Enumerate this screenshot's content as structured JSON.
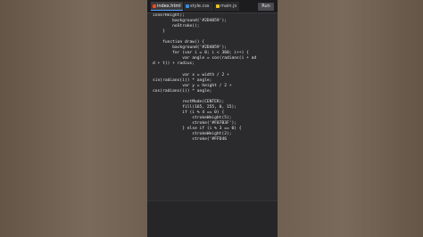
{
  "tabs": [
    {
      "label": "index.html",
      "icon": "html-file-icon",
      "icon_color": "#e44d26"
    },
    {
      "label": "style.css",
      "icon": "css-file-icon",
      "icon_color": "#2d8cf0"
    },
    {
      "label": "main.js",
      "icon": "js-file-icon",
      "icon_color": "#f0c419"
    }
  ],
  "run_label": "Run",
  "code_lines": [
    "innerHeight);",
    "        background('#2D4059');",
    "        noStroke();",
    "    }",
    "",
    "    function draw() {",
    "        background('#2D4059');",
    "        for (var i = 0; i < 360; i++) {",
    "            var angle = cos(radians(i + ad",
    "d + t)) + radius;",
    "",
    "            var x = width / 2 +",
    "sin(radians(i)) * angle;",
    "            var y = height / 2 +",
    "cos(radians(i)) * angle;",
    "",
    "            rectMode(CENTER);",
    "            fill(165, 255, 0, 15);",
    "            if (i % 4 == 0) {",
    "                strokeWeight(5);",
    "                stroke('#F07B3F');",
    "            } else if (i % 3 == 0) {",
    "                strokeWeight(2);",
    "                stroke('#FFD46"
  ],
  "colors": {
    "editor_bg": "#2b2b2d",
    "page_bg": "#6b5b4e",
    "code_text": "#e8e8e8"
  }
}
